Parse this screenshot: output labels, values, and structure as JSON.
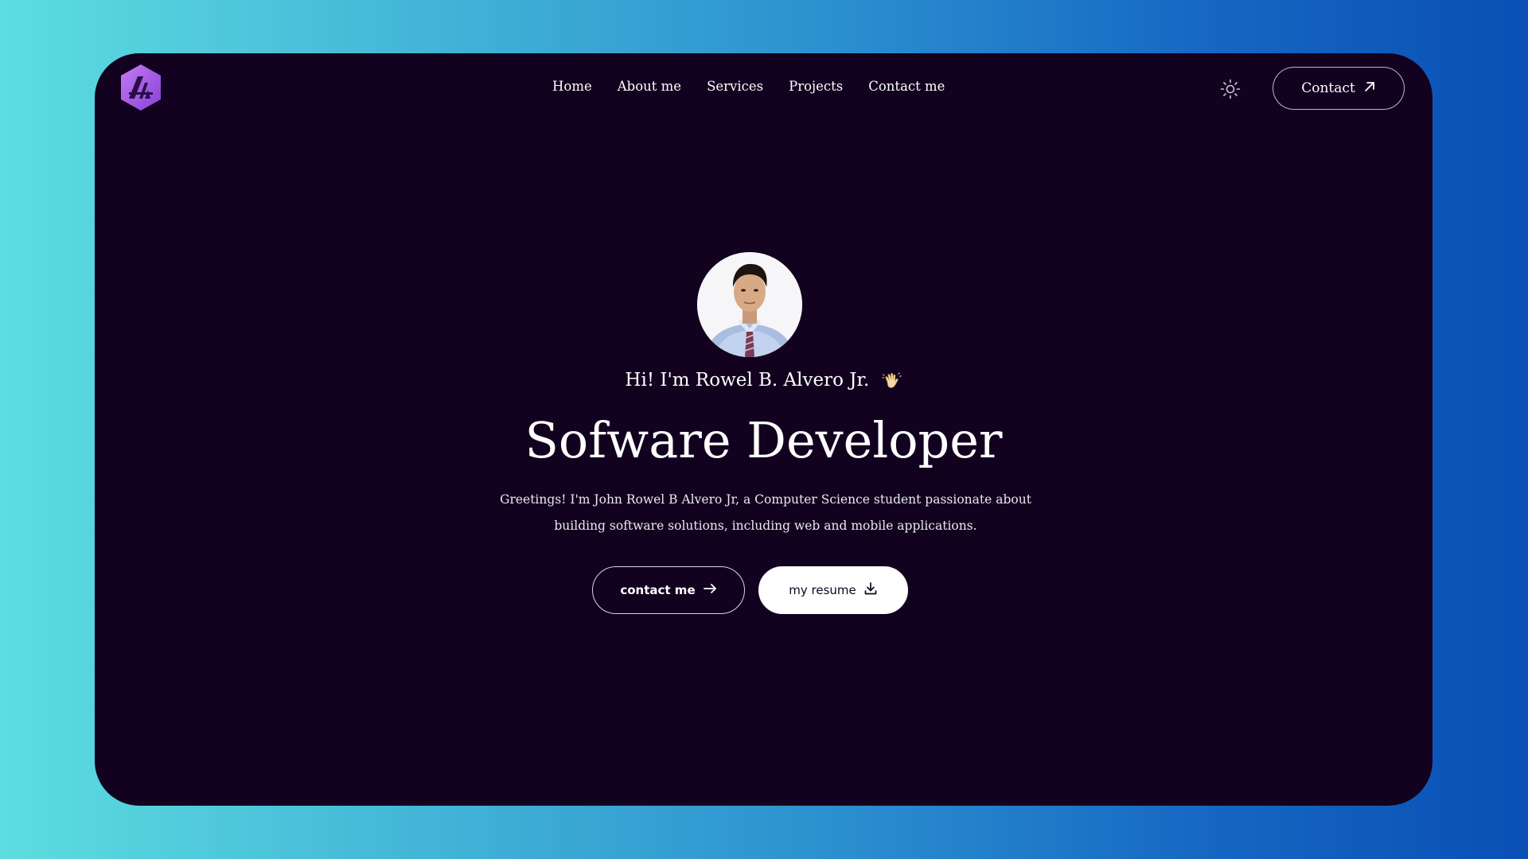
{
  "header": {
    "logo_icon": "hexagon-monogram-logo",
    "nav": [
      {
        "label": "Home"
      },
      {
        "label": "About me"
      },
      {
        "label": "Services"
      },
      {
        "label": "Projects"
      },
      {
        "label": "Contact me"
      }
    ],
    "theme_toggle_icon": "sun-icon",
    "contact_button": {
      "label": "Contact",
      "icon": "arrow-up-right-icon"
    }
  },
  "hero": {
    "avatar_icon": "profile-photo",
    "greeting": "Hi! I'm Rowel B. Alvero Jr.",
    "greeting_icon": "waving-hand-icon",
    "headline": "Sofware Developer",
    "bio": "Greetings! I'm John Rowel B Alvero Jr, a Computer Science student passionate about building software solutions, including web and mobile applications.",
    "buttons": {
      "contact": {
        "label": "contact me",
        "icon": "arrow-right-icon"
      },
      "resume": {
        "label": "my resume",
        "icon": "download-icon"
      }
    }
  },
  "colors": {
    "background_gradient_start": "#5ddde0",
    "background_gradient_end": "#0a4fb5",
    "frame": "#12021f",
    "logo": "#a35be6",
    "text": "#ffffff"
  }
}
